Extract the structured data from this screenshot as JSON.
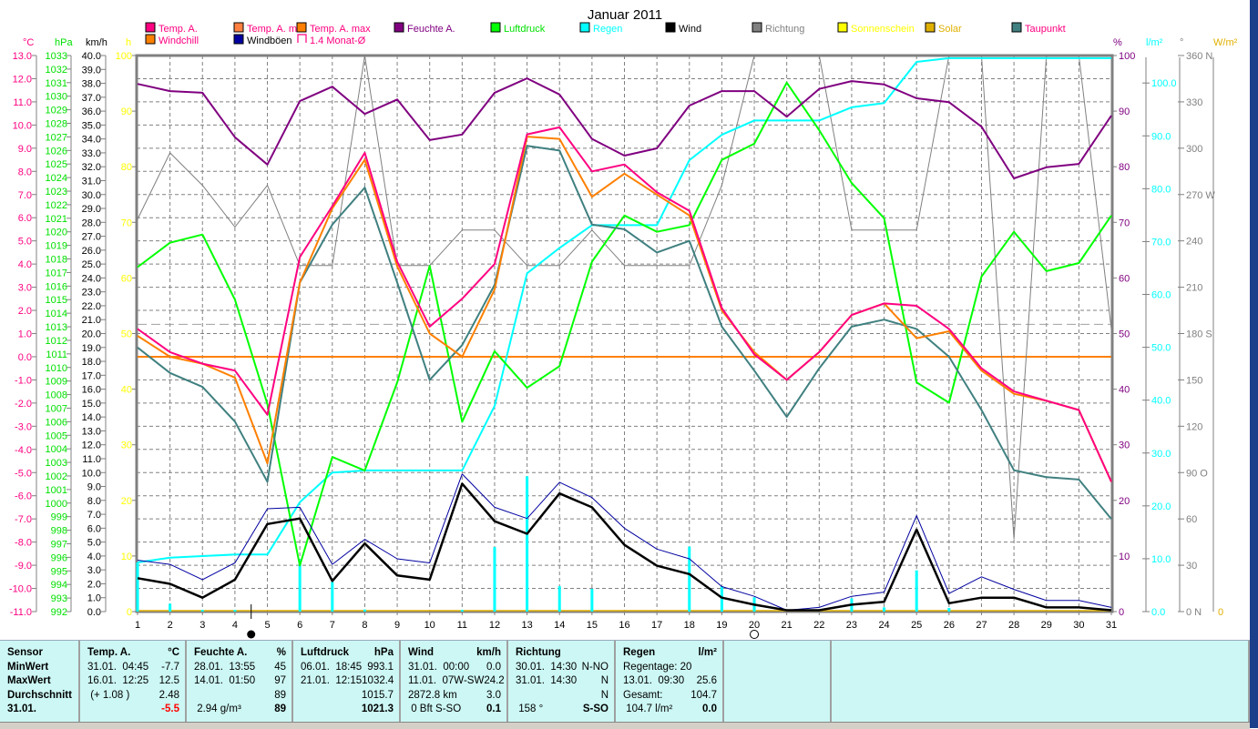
{
  "chart_data": {
    "type": "line",
    "title": "Januar 2011",
    "x": [
      1,
      2,
      3,
      4,
      5,
      6,
      7,
      8,
      9,
      10,
      11,
      12,
      13,
      14,
      15,
      16,
      17,
      18,
      19,
      20,
      21,
      22,
      23,
      24,
      25,
      26,
      27,
      28,
      29,
      30,
      31
    ],
    "grid": true,
    "axes": {
      "temp": {
        "unit": "°C",
        "range": [
          -11,
          13
        ],
        "color": "#ff0080"
      },
      "hpa": {
        "unit": "hPa",
        "range": [
          992,
          1033
        ],
        "color": "#00e000"
      },
      "kmh": {
        "unit": "km/h",
        "range": [
          0,
          40
        ],
        "color": "#000000"
      },
      "h": {
        "unit": "h",
        "range": [
          0,
          100
        ],
        "color": "#ffff00"
      },
      "pct": {
        "unit": "%",
        "range": [
          0,
          100
        ],
        "color": "#800080"
      },
      "rain": {
        "unit": "l/m²",
        "range": [
          0,
          105.2
        ],
        "ticks": [
          0,
          10,
          20,
          30,
          40,
          50,
          60,
          70,
          80,
          90,
          100
        ],
        "color": "#00ffff"
      },
      "deg": {
        "unit": "°",
        "range": [
          0,
          360
        ],
        "ticks": [
          "0 N",
          "30",
          "60",
          "90 O",
          "120",
          "150",
          "180 S",
          "210",
          "240",
          "270 W",
          "300",
          "330",
          "360 N"
        ],
        "color": "#808080"
      },
      "wm2": {
        "unit": "W/m²",
        "ticks": [
          "0"
        ],
        "color": "#e0b000"
      }
    },
    "legend": [
      {
        "name": "Temp. A.",
        "color": "#ff0080",
        "text_color": "#ff0080"
      },
      {
        "name": "Temp. A. min",
        "color": "#ff8040",
        "text_color": "#ff0080"
      },
      {
        "name": "Temp. A. max",
        "color": "#ff8000",
        "text_color": "#ff0080"
      },
      {
        "name": "Feuchte A.",
        "color": "#800080",
        "text_color": "#800080"
      },
      {
        "name": "Luftdruck",
        "color": "#00ff00",
        "text_color": "#00e000"
      },
      {
        "name": "Regen",
        "color": "#00ffff",
        "text_color": "#00ffff"
      },
      {
        "name": "Wind",
        "color": "#000000",
        "text_color": "#000000"
      },
      {
        "name": "Richtung",
        "color": "#808080",
        "text_color": "#808080"
      },
      {
        "name": "Sonnenschein",
        "color": "#ffff00",
        "text_color": "#ffff00"
      },
      {
        "name": "Solar",
        "color": "#e0b000",
        "text_color": "#e0b000"
      },
      {
        "name": "Taupunkt",
        "color": "#408080",
        "text_color": "#ff0080"
      },
      {
        "name": "Windchill",
        "color": "#ff8000",
        "text_color": "#ff0080"
      },
      {
        "name": "Windböen",
        "color": "#0000a0",
        "text_color": "#000000"
      },
      {
        "name": "1.4 Monat-Ø",
        "color": "#ff0080",
        "text_color": "#ff0080",
        "outline": true
      }
    ],
    "monthly_avg_temp": 1.4,
    "series": [
      {
        "name": "Richtung",
        "axis": "deg",
        "color": "#808080",
        "width": 1,
        "values": [
          254,
          297,
          276,
          249,
          276,
          224,
          224,
          360,
          224,
          224,
          247,
          247,
          224,
          224,
          247,
          224,
          224,
          224,
          276,
          360,
          360,
          360,
          247,
          247,
          247,
          360,
          360,
          47,
          360,
          360,
          183
        ]
      },
      {
        "name": "Regen",
        "axis": "rain",
        "color": "#00ffff",
        "width": 2,
        "values": [
          9.3,
          10.2,
          10.5,
          10.8,
          10.8,
          20.7,
          26.3,
          26.7,
          26.7,
          26.7,
          26.7,
          38.9,
          64.0,
          68.8,
          73.1,
          73.1,
          73.1,
          85.4,
          90.2,
          92.9,
          92.9,
          92.9,
          95.4,
          96.2,
          104.0,
          104.7,
          104.7,
          104.7,
          104.7,
          104.7,
          104.7
        ]
      },
      {
        "name": "Luftdruck",
        "axis": "hpa",
        "color": "#00ff00",
        "width": 2,
        "values": [
          1017.4,
          1019.2,
          1019.8,
          1015.0,
          1007.3,
          995.4,
          1003.4,
          1002.4,
          1008.9,
          1017.5,
          1006.0,
          1011.2,
          1008.5,
          1010.1,
          1017.8,
          1021.2,
          1020.0,
          1020.5,
          1025.3,
          1026.5,
          1031.0,
          1027.5,
          1023.6,
          1021.0,
          1008.9,
          1007.4,
          1016.7,
          1020.0,
          1017.1,
          1017.7,
          1021.2
        ]
      },
      {
        "name": "Feuchte A.",
        "axis": "pct",
        "color": "#800080",
        "width": 2,
        "values": [
          94.9,
          93.6,
          93.3,
          85.3,
          80.4,
          91.8,
          94.4,
          89.5,
          92.1,
          84.8,
          85.8,
          93.3,
          95.9,
          93.0,
          85.0,
          82.0,
          83.3,
          91.0,
          93.6,
          93.6,
          89.0,
          94.0,
          95.4,
          94.8,
          92.3,
          91.6,
          87.2,
          77.9,
          79.9,
          80.5,
          89.2
        ]
      },
      {
        "name": "Taupunkt",
        "axis": "temp",
        "color": "#408080",
        "width": 2,
        "values": [
          0.4,
          -0.7,
          -1.3,
          -2.8,
          -5.4,
          3.2,
          5.7,
          7.3,
          3.2,
          -1.0,
          0.5,
          3.1,
          9.1,
          8.9,
          5.7,
          5.5,
          4.5,
          5.0,
          1.3,
          -0.6,
          -2.6,
          -0.5,
          1.3,
          1.6,
          1.2,
          0.0,
          -2.3,
          -4.9,
          -5.2,
          -5.3,
          -7.0
        ]
      },
      {
        "name": "Temp. A. min",
        "axis": "temp",
        "color": "#ff8000",
        "width": 2,
        "values": [
          0.9,
          0.0,
          -0.3,
          -0.9,
          -4.6,
          3.2,
          6.4,
          8.5,
          3.9,
          1.0,
          0.0,
          2.9,
          9.5,
          9.4,
          6.9,
          7.9,
          7.0,
          6.1,
          2.0,
          0.2,
          -1.0,
          0.2,
          1.8,
          2.3,
          0.8,
          1.1,
          -0.6,
          -1.6,
          -1.9,
          -2.3,
          -5.4
        ]
      },
      {
        "name": "Temp. A.",
        "axis": "temp",
        "color": "#ff0080",
        "width": 2,
        "values": [
          1.2,
          0.2,
          -0.3,
          -0.6,
          -2.5,
          4.3,
          6.5,
          8.8,
          4.1,
          1.3,
          2.5,
          4.0,
          9.6,
          9.9,
          8.0,
          8.3,
          7.1,
          6.3,
          2.1,
          0.1,
          -1.0,
          0.2,
          1.8,
          2.3,
          2.2,
          1.2,
          -0.5,
          -1.5,
          -1.9,
          -2.3,
          -5.4
        ]
      },
      {
        "name": "Windböen",
        "axis": "kmh",
        "color": "#0000a0",
        "width": 1,
        "values": [
          3.7,
          3.4,
          2.3,
          3.5,
          7.4,
          7.5,
          3.4,
          5.2,
          3.8,
          3.5,
          9.9,
          7.5,
          6.7,
          9.3,
          8.2,
          6.0,
          4.5,
          3.8,
          1.8,
          1.1,
          0.1,
          0.3,
          1.1,
          1.4,
          6.9,
          1.3,
          2.5,
          1.6,
          0.8,
          0.8,
          0.3
        ]
      },
      {
        "name": "Wind",
        "axis": "kmh",
        "color": "#000000",
        "width": 2.5,
        "values": [
          2.4,
          2.0,
          1.0,
          2.3,
          6.3,
          6.7,
          2.2,
          4.9,
          2.6,
          2.3,
          9.2,
          6.5,
          5.6,
          8.5,
          7.5,
          4.8,
          3.3,
          2.7,
          1.0,
          0.5,
          0.1,
          0.1,
          0.5,
          0.7,
          5.9,
          0.6,
          1.0,
          1.0,
          0.3,
          0.3,
          0.1
        ]
      }
    ],
    "daily_rain": {
      "name": "Regen",
      "axis": "rain",
      "color": "#00ffff",
      "values": [
        9.3,
        1.5,
        0.2,
        0.2,
        0,
        9.9,
        5.6,
        0.4,
        0,
        0,
        0.2,
        12.2,
        25.6,
        4.8,
        4.3,
        0,
        0,
        12.3,
        4.8,
        2.7,
        0,
        0,
        2.5,
        0.8,
        7.8,
        0.7,
        0,
        0,
        0,
        0,
        0
      ]
    },
    "moon": [
      {
        "day": 4.5,
        "phase": "new"
      },
      {
        "day": 20,
        "phase": "full"
      }
    ]
  },
  "stats": {
    "columns": [
      {
        "header": [
          "Sensor",
          ""
        ],
        "rows": [
          [
            "MinWert",
            ""
          ],
          [
            "MaxWert",
            ""
          ],
          [
            "Durchschnitt",
            ""
          ],
          [
            "31.01.",
            ""
          ]
        ],
        "bold_left": true
      },
      {
        "header": [
          "Temp. A.",
          "°C"
        ],
        "rows": [
          [
            "31.01.  04:45",
            "-7.7"
          ],
          [
            "16.01.  12:25",
            "12.5"
          ],
          [
            " (+ 1.08 )",
            "2.48"
          ],
          [
            "",
            "-5.5"
          ]
        ],
        "last_right_color": "#ff0000"
      },
      {
        "header": [
          "Feuchte A.",
          "%"
        ],
        "rows": [
          [
            "28.01.  13:55",
            "45"
          ],
          [
            "14.01.  01:50",
            "97"
          ],
          [
            "",
            "89"
          ],
          [
            " 2.94 g/m³",
            "89"
          ]
        ]
      },
      {
        "header": [
          "Luftdruck",
          "hPa"
        ],
        "rows": [
          [
            "06.01.  18:45",
            "993.1"
          ],
          [
            "21.01.  12:15",
            "1032.4"
          ],
          [
            "",
            "1015.7"
          ],
          [
            "",
            "1021.3"
          ]
        ]
      },
      {
        "header": [
          "Wind",
          "km/h"
        ],
        "rows": [
          [
            "31.01.  00:00",
            "0.0"
          ],
          [
            "11.01.  07W-SW",
            "24.2"
          ],
          [
            "2872.8 km",
            "3.0"
          ],
          [
            " 0 Bft S-SO",
            "0.1"
          ]
        ]
      },
      {
        "header": [
          "Richtung",
          ""
        ],
        "rows": [
          [
            "30.01.  14:30",
            "N-NO"
          ],
          [
            "31.01.  14:30",
            "N"
          ],
          [
            "",
            "N"
          ],
          [
            " 158 °",
            "S-SO"
          ]
        ]
      },
      {
        "header": [
          "Regen",
          "l/m²"
        ],
        "rows": [
          [
            "Regentage: 20",
            ""
          ],
          [
            "13.01.  09:30",
            "25.6"
          ],
          [
            "Gesamt:",
            "104.7"
          ],
          [
            " 104.7 l/m²",
            "0.0"
          ]
        ]
      },
      {
        "header": [
          "",
          ""
        ],
        "rows": []
      },
      {
        "header": [
          "",
          ""
        ],
        "rows": []
      }
    ]
  }
}
